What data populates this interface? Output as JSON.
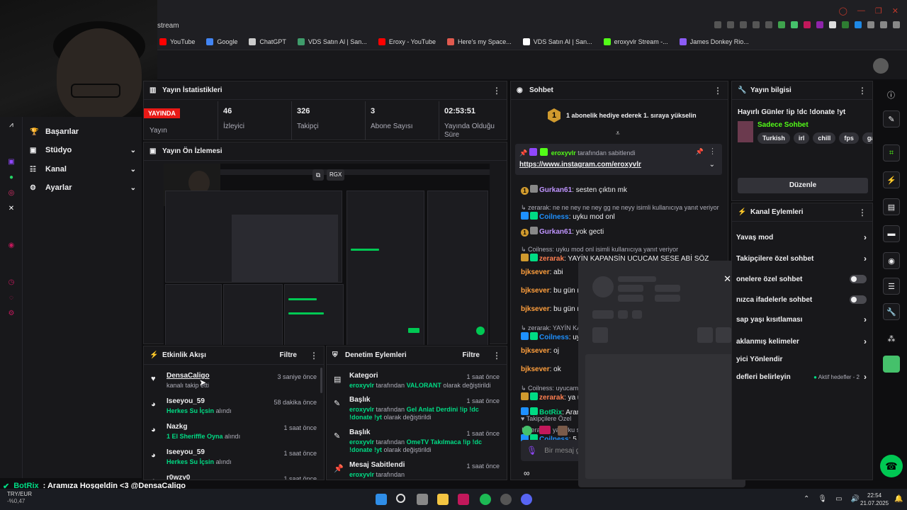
{
  "browser": {
    "tab_fragment": "stream",
    "bookmarks": [
      {
        "label": "YouTube",
        "color": "#ff0000"
      },
      {
        "label": "Google",
        "color": "#4285f4"
      },
      {
        "label": "ChatGPT",
        "color": "#cccccc"
      },
      {
        "label": "VDS Satın Al | San...",
        "color": "#3f9c6b"
      },
      {
        "label": "Eroxy - YouTube",
        "color": "#ff0000"
      },
      {
        "label": "Here's my Space...",
        "color": "#e05a4f"
      },
      {
        "label": "VDS Satın Al | San...",
        "color": "#ffffff"
      },
      {
        "label": "eroxyvlr Stream -...",
        "color": "#53fc18"
      },
      {
        "label": "James Donkey Rio...",
        "color": "#8b5cf6"
      }
    ]
  },
  "leftnav": {
    "items": [
      {
        "label": "Başarılar",
        "icon": "trophy-icon",
        "glyph": "🏆",
        "chevron": false
      },
      {
        "label": "Stüdyo",
        "icon": "studio-icon",
        "glyph": "▣",
        "chevron": true
      },
      {
        "label": "Kanal",
        "icon": "channel-icon",
        "glyph": "☷",
        "chevron": true
      },
      {
        "label": "Ayarlar",
        "icon": "settings-icon",
        "glyph": "⚙",
        "chevron": true
      }
    ]
  },
  "stats": {
    "title": "Yayın İstatistikleri",
    "live_badge": "YAYINDA",
    "live_label": "Yayın",
    "items": [
      {
        "value": "46",
        "label": "İzleyici"
      },
      {
        "value": "326",
        "label": "Takipçi"
      },
      {
        "value": "3",
        "label": "Abone Sayısı"
      },
      {
        "value": "02:53:51",
        "label": "Yayında Olduğu Süre"
      }
    ]
  },
  "preview": {
    "title": "Yayın Ön İzlemesi",
    "overlay_label": "RGX"
  },
  "activity": {
    "title": "Etkinlik Akışı",
    "filter": "Filtre",
    "events": [
      {
        "name": "DensaCaligo",
        "time": "3 saniye önce",
        "desc": "kanalı takip etti",
        "highlight": "",
        "icon": "heart-icon",
        "glyph": "♥"
      },
      {
        "name": "Iseeyou_59",
        "time": "58 dakika önce",
        "desc": "alındı",
        "highlight": "Herkes Su İçsin",
        "icon": "channel-points-icon",
        "glyph": "◕"
      },
      {
        "name": "Nazkg",
        "time": "1 saat önce",
        "desc": "alındı",
        "highlight": "1 El Sheriffle Oyna",
        "icon": "channel-points-icon",
        "glyph": "◕"
      },
      {
        "name": "Iseeyou_59",
        "time": "1 saat önce",
        "desc": "alındı",
        "highlight": "Herkes Su İçsin",
        "icon": "channel-points-icon",
        "glyph": "◕"
      },
      {
        "name": "r0wzy0",
        "time": "1 saat önce",
        "desc": "",
        "highlight": "",
        "icon": "channel-points-icon",
        "glyph": "◕"
      }
    ]
  },
  "moderation": {
    "title": "Denetim Eylemleri",
    "filter": "Filtre",
    "actions": [
      {
        "title": "Kategori",
        "time": "1 saat önce",
        "actor": "eroxyvlr",
        "pre": " tarafından ",
        "value": "VALORANT",
        "post": " olarak değiştirildi",
        "icon": "category-icon",
        "glyph": "▤"
      },
      {
        "title": "Başlık",
        "time": "1 saat önce",
        "actor": "eroxyvlr",
        "pre": " tarafından ",
        "value": "Gel Anlat Derdini !ip !dc !donate !yt",
        "post": " olarak değiştirildi",
        "icon": "title-icon",
        "glyph": "✎"
      },
      {
        "title": "Başlık",
        "time": "1 saat önce",
        "actor": "eroxyvlr",
        "pre": " tarafından ",
        "value": "OmeTV Takılmaca !ip !dc !donate !yt",
        "post": " olarak değiştirildi",
        "icon": "title-icon",
        "glyph": "✎"
      },
      {
        "title": "Mesaj Sabitlendi",
        "time": "1 saat önce",
        "actor": "eroxyvlr",
        "pre": " tarafından",
        "value": "",
        "post": "",
        "icon": "pin-icon",
        "glyph": "📌"
      }
    ]
  },
  "chat": {
    "title": "Sohbet",
    "hype": "1 abonelik hediye ederek 1. sıraya yükselin",
    "hype_rank": "1",
    "pinned_by": "eroxyvlr",
    "pinned_suffix": " tarafından sabitlendi",
    "pinned_link": "https://www.instagram.com/eroxyvlr",
    "messages": [
      {
        "reply": "",
        "user": "Gurkan61",
        "color": "#bf94ff",
        "text": ": sesten çıktın mk"
      },
      {
        "reply": "zerarak: ne ne ney ne ney gg ne neyy isimli kullanıcıya yanıt veriyor",
        "user": "Coilness",
        "color": "#1e90ff",
        "text": ": uyku mod onl"
      },
      {
        "reply": "",
        "user": "Gurkan61",
        "color": "#bf94ff",
        "text": ": yok gecti"
      },
      {
        "reply": "Coilness: uyku mod onl isimli kullanıcıya yanıt veriyor",
        "user": "zerarak",
        "color": "#ff7f50",
        "text": ": YAYİN KAPANSİN UCUCAM SESE ABİ SÖZ"
      },
      {
        "reply": "",
        "user": "bjksever",
        "color": "#ff9f3d",
        "text": ": abi"
      },
      {
        "reply": "",
        "user": "bjksever",
        "color": "#ff9f3d",
        "text": ": bu gün mo"
      },
      {
        "reply": "",
        "user": "bjksever",
        "color": "#ff9f3d",
        "text": ": bu gün mo"
      },
      {
        "reply": "zerarak: YAYİN KA",
        "user": "Coilness",
        "color": "#1e90ff",
        "text": ": uy"
      },
      {
        "reply": "",
        "user": "bjksever",
        "color": "#ff9f3d",
        "text": ": oj"
      },
      {
        "reply": "",
        "user": "bjksever",
        "color": "#ff9f3d",
        "text": ": ok"
      },
      {
        "reply": "Coilness: uyucam",
        "user": "zerarak",
        "color": "#ff7f50",
        "text": ": ya u"
      },
      {
        "reply": "",
        "user": "BotRix",
        "color": "#00db84",
        "text": ": Aram"
      },
      {
        "reply": "zerarak: ya uyku s",
        "user": "Coilness",
        "color": "#1e90ff",
        "text": ": 5"
      }
    ],
    "followers_only_label": "Takipçilere Özel",
    "input_placeholder": "Bir mesaj g"
  },
  "stream_info": {
    "title": "Yayın bilgisi",
    "stream_title": "Hayırlı Günler !ip !dc !donate !yt",
    "category": "Sadece Sohbet",
    "tags": [
      "Turkish",
      "irl",
      "chill",
      "fps",
      "gamir"
    ],
    "edit_button": "Düzenle"
  },
  "channel_actions": {
    "title": "Kanal Eylemleri",
    "items": [
      {
        "label": "Yavaş mod",
        "control": "chevron"
      },
      {
        "label": "Takipçilere özel sohbet",
        "control": "chevron"
      },
      {
        "label": "onelere özel sohbet",
        "control": "toggle"
      },
      {
        "label": "nızca ifadelerle sohbet",
        "control": "toggle"
      },
      {
        "label": "sap yaşı kısıtlaması",
        "control": "chevron"
      },
      {
        "label": "aklanmış kelimeler",
        "control": "chevron"
      },
      {
        "label": "yici Yönlendir",
        "control": "none"
      },
      {
        "label": "defleri belirleyin",
        "control": "goal"
      }
    ],
    "goal_text": "Aktif hedefler - 2"
  },
  "ticker": {
    "user": "BotRix",
    "text": ": Aramıza Hoşgeldin <3 @DensaCaligo",
    "currency": "TRY/EUR",
    "change": "-%0,47"
  },
  "taskbar": {
    "time": "22:54",
    "date": "21.07.2025"
  },
  "colors": {
    "accent": "#9147ff",
    "live": "#e91916",
    "highlight_green": "#00db84"
  }
}
